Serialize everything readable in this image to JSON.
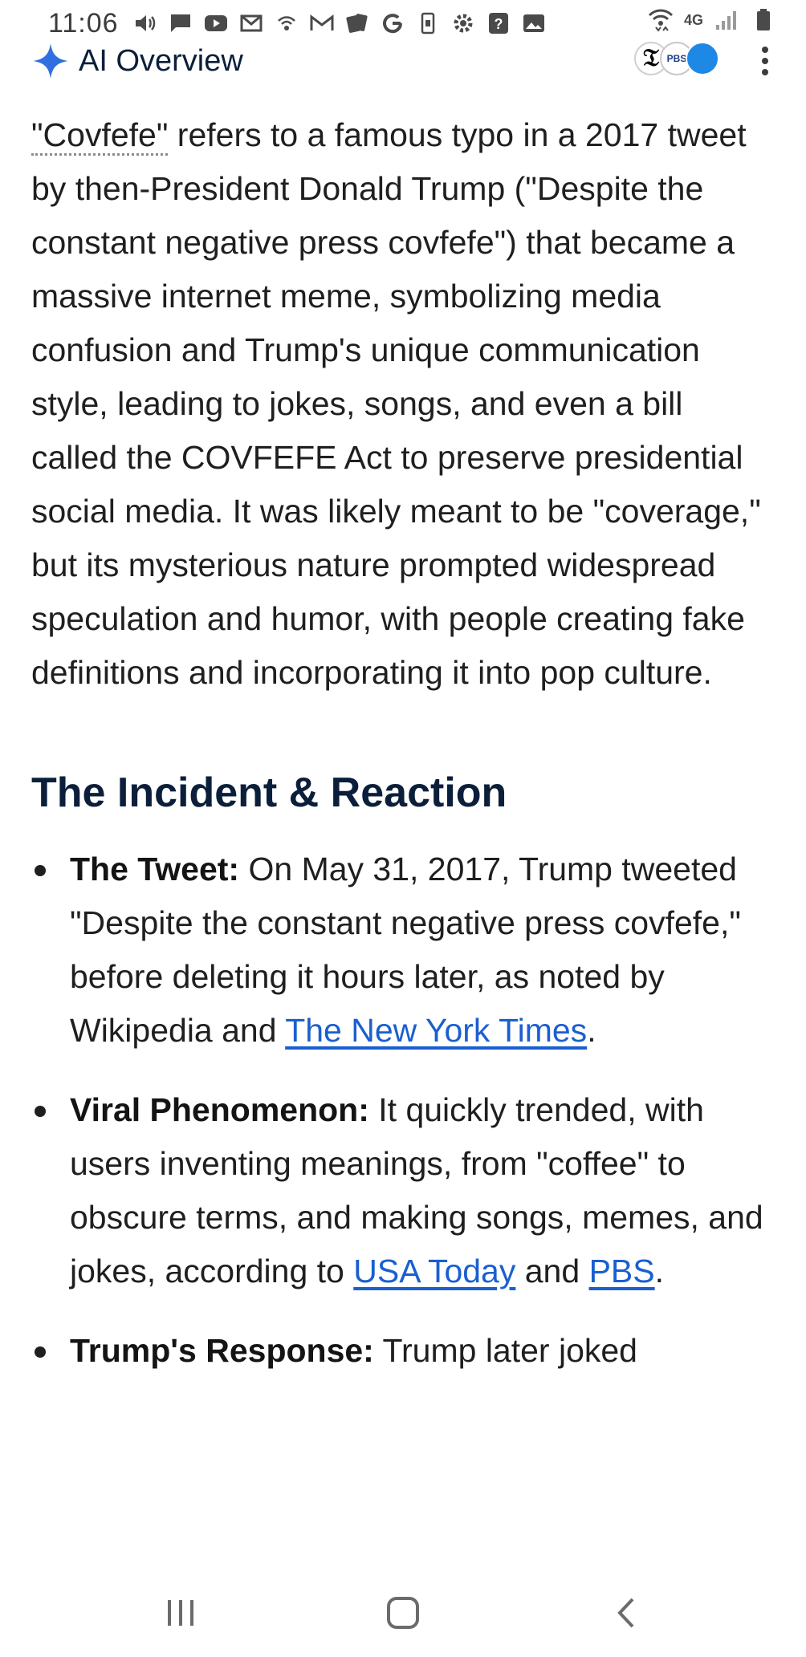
{
  "status_bar": {
    "time": "11:06",
    "network_label": "4G",
    "icons": [
      "volume-icon",
      "chat-icon",
      "youtube-icon",
      "mail-icon",
      "wifi-call-icon",
      "gmail-icon",
      "cards-icon",
      "google-icon",
      "phone-icon",
      "settings-icon",
      "help-icon",
      "gallery-icon",
      "wifi-icon",
      "signal-icon",
      "battery-icon"
    ]
  },
  "ai_overview": {
    "title": "AI Overview",
    "source_badges": [
      "nyt-logo",
      "pbs-logo",
      "usa-today-logo"
    ],
    "pbs_label": "PBS"
  },
  "summary": {
    "term": "\"Covfefe\"",
    "text": " refers to a famous typo in a 2017 tweet by then-President Donald Trump (\"Despite the constant negative press covfefe\") that became a massive internet meme, symbolizing media confusion and Trump's unique communication style, leading to jokes, songs, and even a bill called the COVFEFE Act to preserve presidential social media. It was likely meant to be \"coverage,\" but its mysterious nature prompted widespread speculation and humor, with people creating fake definitions and incorporating it into pop culture."
  },
  "section": {
    "heading": "The Incident & Reaction",
    "bullets": [
      {
        "label": "The Tweet:",
        "text": " On May 31, 2017, Trump tweeted \"Despite the constant negative press covfefe,\" before deleting it hours later, as noted by Wikipedia and ",
        "link1": "The New York Times",
        "between": "",
        "link2": "",
        "end": "."
      },
      {
        "label": "Viral Phenomenon:",
        "text": " It quickly trended, with users inventing meanings, from \"coffee\" to obscure terms, and making songs, memes, and jokes, according to ",
        "link1": "USA Today",
        "between": " and ",
        "link2": "PBS",
        "end": "."
      },
      {
        "label": "Trump's Response:",
        "text": " Trump later joked"
      }
    ]
  },
  "nav_bar": {
    "buttons": [
      "recents-button",
      "home-button",
      "back-button"
    ]
  },
  "colors": {
    "link": "#1a5fd0",
    "heading": "#0b1f3a",
    "body_text": "#1f1f1f",
    "spark_blue": "#2f6fe0"
  }
}
